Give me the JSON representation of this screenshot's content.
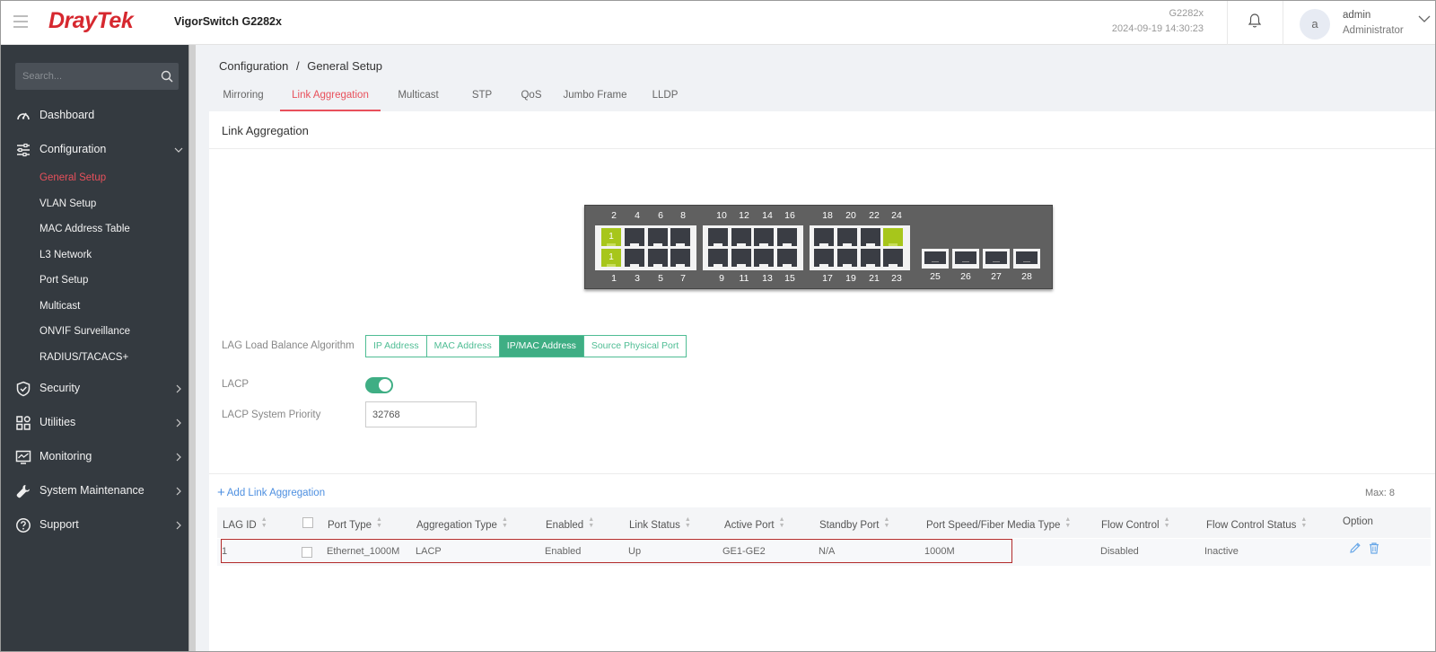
{
  "header": {
    "brand_dray": "Dray",
    "brand_tek": "Tek",
    "product": "VigorSwitch G2282x",
    "model": "G2282x",
    "datetime": "2024-09-19 14:30:23",
    "avatar_letter": "a",
    "user_name": "admin",
    "user_role": "Administrator"
  },
  "sidebar": {
    "search_placeholder": "Search...",
    "items": [
      {
        "label": "Dashboard",
        "icon": "dashboard-icon"
      },
      {
        "label": "Configuration",
        "icon": "sliders-icon"
      },
      {
        "label": "Security",
        "icon": "shield-icon"
      },
      {
        "label": "Utilities",
        "icon": "grid-icon"
      },
      {
        "label": "Monitoring",
        "icon": "monitor-icon"
      },
      {
        "label": "System Maintenance",
        "icon": "wrench-icon"
      },
      {
        "label": "Support",
        "icon": "help-icon"
      }
    ],
    "config_sub": [
      "General Setup",
      "VLAN Setup",
      "MAC Address Table",
      "L3 Network",
      "Port Setup",
      "Multicast",
      "ONVIF Surveillance",
      "RADIUS/TACACS+"
    ],
    "active_sub": "General Setup"
  },
  "breadcrumb": {
    "parent": "Configuration",
    "separator": "/",
    "current": "General Setup"
  },
  "tabs": [
    "Mirroring",
    "Link Aggregation",
    "Multicast",
    "STP",
    "QoS",
    "Jumbo Frame",
    "LLDP"
  ],
  "active_tab": "Link Aggregation",
  "panel_title": "Link Aggregation",
  "switch": {
    "top_labels_g1": [
      "2",
      "4",
      "6",
      "8"
    ],
    "top_labels_g2": [
      "10",
      "12",
      "14",
      "16"
    ],
    "top_labels_g3": [
      "18",
      "20",
      "22",
      "24"
    ],
    "bottom_labels_g1": [
      "1",
      "3",
      "5",
      "7"
    ],
    "bottom_labels_g2": [
      "9",
      "11",
      "13",
      "15"
    ],
    "bottom_labels_g3": [
      "17",
      "19",
      "21",
      "23"
    ],
    "sfp_labels": [
      "25",
      "26",
      "27",
      "28"
    ],
    "lag_port_text": "1"
  },
  "settings": {
    "algo_label": "LAG Load Balance Algorithm",
    "algo_options": [
      "IP Address",
      "MAC Address",
      "IP/MAC Address",
      "Source Physical Port"
    ],
    "algo_selected": "IP/MAC Address",
    "lacp_label": "LACP",
    "lacp_enabled": true,
    "priority_label": "LACP System Priority",
    "priority_value": "32768"
  },
  "table": {
    "add_label": "Add Link Aggregation",
    "max_label": "Max: 8",
    "columns": [
      "LAG ID",
      "Port Type",
      "Aggregation Type",
      "Enabled",
      "Link Status",
      "Active Port",
      "Standby Port",
      "Port Speed/Fiber Media Type",
      "Flow Control",
      "Flow Control Status",
      "Option"
    ],
    "rows": [
      {
        "lag_id": "1",
        "port_type": "Ethernet_1000M",
        "aggregation_type": "LACP",
        "enabled": "Enabled",
        "link_status": "Up",
        "active_port": "GE1-GE2",
        "standby_port": "N/A",
        "port_speed": "1000M",
        "flow_control": "Disabled",
        "flow_control_status": "Inactive"
      }
    ]
  },
  "colors": {
    "accent_red": "#e8505b",
    "accent_green": "#3fae84",
    "lag_port": "#a7c61b",
    "sidebar_bg": "#343a40"
  }
}
